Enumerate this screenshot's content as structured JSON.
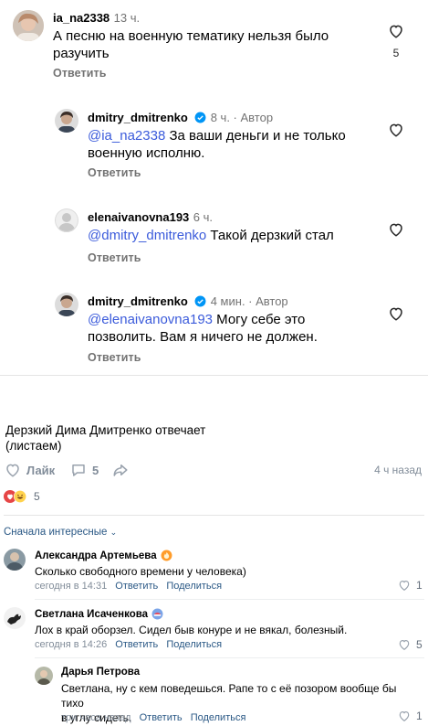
{
  "ig_comments": [
    {
      "username": "ia_na2338",
      "time": "13 ч.",
      "text": "А песню на военную тематику нельзя было разучить",
      "reply": "Ответить",
      "likes": "5"
    },
    {
      "username": "dmitry_dmitrenko",
      "time": "8 ч. · Автор",
      "mention": "@ia_na2338",
      "text": " За ваши деньги и не только военную исполню.",
      "reply": "Ответить"
    },
    {
      "username": "elenaivanovna193",
      "time": "6 ч.",
      "mention": "@dmitry_dmitrenko",
      "text": " Такой дерзкий стал",
      "reply": "Ответить"
    },
    {
      "username": "dmitry_dmitrenko",
      "time": "4 мин. · Автор",
      "mention": "@elenaivanovna193",
      "text": " Могу себе это позволить. Вам я ничего не должен.",
      "reply": "Ответить"
    }
  ],
  "post": {
    "text_line1": "Дерзкий Дима Дмитренко отвечает",
    "text_line2": "(листаем)",
    "like_label": "Лайк",
    "comments_count": "5",
    "time": "4 ч назад",
    "reactions_count": "5"
  },
  "sort_label": "Сначала интересные",
  "vk_comments": [
    {
      "name": "Александра Артемьева",
      "text": "Сколько свободного времени у человека)",
      "date": "сегодня в 14:31",
      "reply": "Ответить",
      "share": "Поделиться",
      "likes": "1"
    },
    {
      "name": "Светлана Исаченкова",
      "text": "Лох в край оборзел. Сидел быв конуре и не вякал, болезный.",
      "date": "сегодня в 14:26",
      "reply": "Ответить",
      "share": "Поделиться",
      "likes": "5"
    },
    {
      "name": "Дарья Петрова",
      "text_line1": "Светлана, ну с кем поведешься. Рапе то с её позором вообще бы тихо",
      "text_line2": "в углу сидеть.",
      "date": "три часа назад",
      "reply": "Ответить",
      "share": "Поделиться",
      "likes": "1"
    }
  ],
  "colors": {
    "mention": "#3b5bdb",
    "verified": "#0095f6",
    "vk_link": "#2a5885",
    "vk_gray": "#818c99",
    "heart_red": "#e64646"
  }
}
